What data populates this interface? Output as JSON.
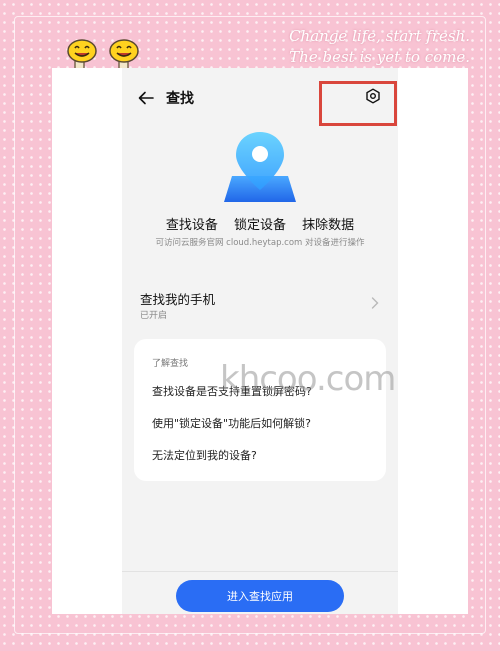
{
  "decoration": {
    "slogan_line1": "Change life, start fresh.",
    "slogan_line2": "The best is yet to come.",
    "watermark": "khcoo.com"
  },
  "header": {
    "title": "查找",
    "back_icon": "arrow-left-icon",
    "settings_icon": "gear-icon"
  },
  "hero": {
    "icon": "location-map-icon",
    "features": [
      "查找设备",
      "锁定设备",
      "抹除数据"
    ],
    "subtitle": "可访问云服务官网 cloud.heytap.com 对设备进行操作"
  },
  "find_phone": {
    "title": "查找我的手机",
    "status": "已开启"
  },
  "faq": {
    "header": "了解查找",
    "items": [
      "查找设备是否支持重置锁屏密码?",
      "使用\"锁定设备\"功能后如何解锁?",
      "无法定位到我的设备?"
    ]
  },
  "footer": {
    "button_label": "进入查找应用"
  },
  "colors": {
    "frame_pink": "#f8c3d3",
    "accent_blue": "#2a6df4",
    "highlight_red": "#d9463c"
  }
}
